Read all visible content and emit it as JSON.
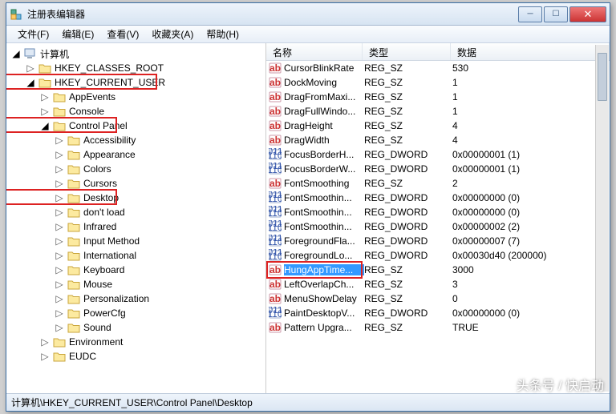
{
  "window": {
    "title": "注册表编辑器"
  },
  "menu": [
    "文件(F)",
    "编辑(E)",
    "查看(V)",
    "收藏夹(A)",
    "帮助(H)"
  ],
  "tree": {
    "root": "计算机",
    "hkcr": "HKEY_CLASSES_ROOT",
    "hkcu": "HKEY_CURRENT_USER",
    "hkcu_children": [
      {
        "label": "AppEvents",
        "depth": 2
      },
      {
        "label": "Console",
        "depth": 2
      },
      {
        "label": "Control Panel",
        "depth": 2,
        "expanded": true,
        "red": true
      },
      {
        "label": "Accessibility",
        "depth": 3
      },
      {
        "label": "Appearance",
        "depth": 3
      },
      {
        "label": "Colors",
        "depth": 3
      },
      {
        "label": "Cursors",
        "depth": 3
      },
      {
        "label": "Desktop",
        "depth": 3,
        "red": true
      },
      {
        "label": "don't load",
        "depth": 3
      },
      {
        "label": "Infrared",
        "depth": 3
      },
      {
        "label": "Input Method",
        "depth": 3
      },
      {
        "label": "International",
        "depth": 3
      },
      {
        "label": "Keyboard",
        "depth": 3
      },
      {
        "label": "Mouse",
        "depth": 3
      },
      {
        "label": "Personalization",
        "depth": 3
      },
      {
        "label": "PowerCfg",
        "depth": 3
      },
      {
        "label": "Sound",
        "depth": 3
      },
      {
        "label": "Environment",
        "depth": 2
      },
      {
        "label": "EUDC",
        "depth": 2
      }
    ]
  },
  "list": {
    "headers": {
      "name": "名称",
      "type": "类型",
      "data": "数据"
    },
    "rows": [
      {
        "icon": "sz",
        "name": "CursorBlinkRate",
        "type": "REG_SZ",
        "data": "530"
      },
      {
        "icon": "sz",
        "name": "DockMoving",
        "type": "REG_SZ",
        "data": "1"
      },
      {
        "icon": "sz",
        "name": "DragFromMaxi...",
        "type": "REG_SZ",
        "data": "1"
      },
      {
        "icon": "sz",
        "name": "DragFullWindo...",
        "type": "REG_SZ",
        "data": "1"
      },
      {
        "icon": "sz",
        "name": "DragHeight",
        "type": "REG_SZ",
        "data": "4"
      },
      {
        "icon": "sz",
        "name": "DragWidth",
        "type": "REG_SZ",
        "data": "4"
      },
      {
        "icon": "dw",
        "name": "FocusBorderH...",
        "type": "REG_DWORD",
        "data": "0x00000001 (1)"
      },
      {
        "icon": "dw",
        "name": "FocusBorderW...",
        "type": "REG_DWORD",
        "data": "0x00000001 (1)"
      },
      {
        "icon": "sz",
        "name": "FontSmoothing",
        "type": "REG_SZ",
        "data": "2"
      },
      {
        "icon": "dw",
        "name": "FontSmoothin...",
        "type": "REG_DWORD",
        "data": "0x00000000 (0)"
      },
      {
        "icon": "dw",
        "name": "FontSmoothin...",
        "type": "REG_DWORD",
        "data": "0x00000000 (0)"
      },
      {
        "icon": "dw",
        "name": "FontSmoothin...",
        "type": "REG_DWORD",
        "data": "0x00000002 (2)"
      },
      {
        "icon": "dw",
        "name": "ForegroundFla...",
        "type": "REG_DWORD",
        "data": "0x00000007 (7)"
      },
      {
        "icon": "dw",
        "name": "ForegroundLo...",
        "type": "REG_DWORD",
        "data": "0x00030d40 (200000)"
      },
      {
        "icon": "sz",
        "name": "HungAppTime...",
        "type": "REG_SZ",
        "data": "3000",
        "selected": true,
        "red": true
      },
      {
        "icon": "sz",
        "name": "LeftOverlapCh...",
        "type": "REG_SZ",
        "data": "3"
      },
      {
        "icon": "sz",
        "name": "MenuShowDelay",
        "type": "REG_SZ",
        "data": "0"
      },
      {
        "icon": "dw",
        "name": "PaintDesktopV...",
        "type": "REG_DWORD",
        "data": "0x00000000 (0)"
      },
      {
        "icon": "sz",
        "name": "Pattern Upgra...",
        "type": "REG_SZ",
        "data": "TRUE"
      }
    ]
  },
  "statusbar": "计算机\\HKEY_CURRENT_USER\\Control Panel\\Desktop",
  "watermark": "头条号 / 快启动"
}
